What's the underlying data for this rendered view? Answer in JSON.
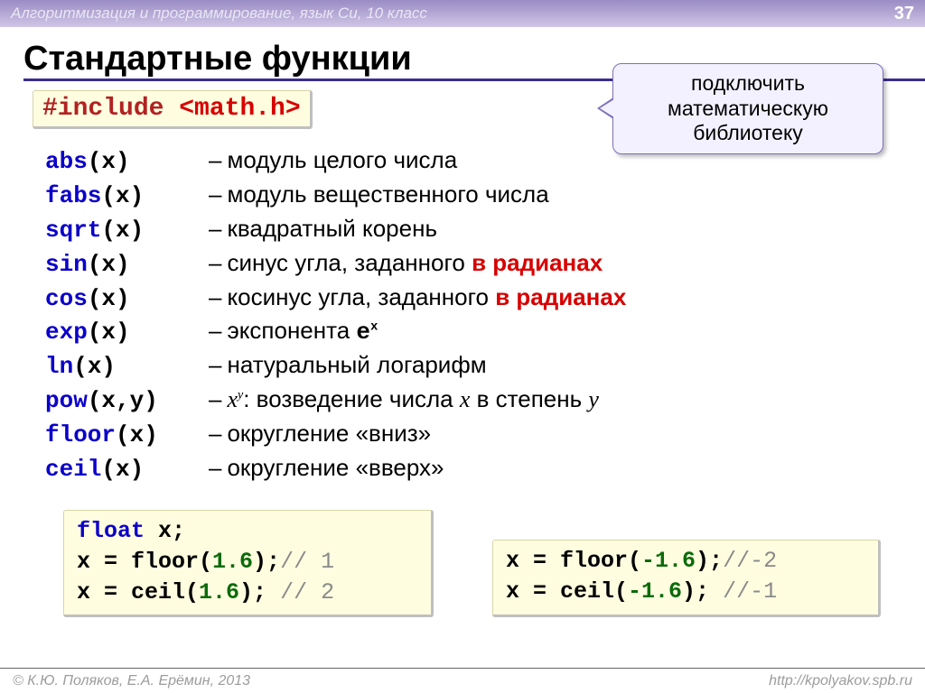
{
  "header": {
    "course": "Алгоритмизация и программирование, язык Си, 10 класс",
    "page": "37"
  },
  "heading": "Стандартные функции",
  "include": {
    "directive": "#include",
    "lib": "<math.h>"
  },
  "callout": "подключить математическую библиотеку",
  "functions": [
    {
      "name": "abs",
      "sig": "(x)",
      "desc_pre": "модуль целого числа",
      "desc_red": "",
      "desc_post": ""
    },
    {
      "name": "fabs",
      "sig": "(x)",
      "desc_pre": "модуль вещественного числа",
      "desc_red": "",
      "desc_post": ""
    },
    {
      "name": "sqrt",
      "sig": "(x)",
      "desc_pre": "квадратный корень",
      "desc_red": "",
      "desc_post": ""
    },
    {
      "name": "sin",
      "sig": "(x)",
      "desc_pre": "синус угла, заданного ",
      "desc_red": "в радианах",
      "desc_post": ""
    },
    {
      "name": "cos",
      "sig": "(x)",
      "desc_pre": "косинус угла, заданного ",
      "desc_red": "в радианах",
      "desc_post": ""
    },
    {
      "name": "exp",
      "sig": "(x)",
      "desc_pre": "экспонента ",
      "desc_red": "",
      "desc_post": "",
      "math_base": "e",
      "math_sup": "x"
    },
    {
      "name": "ln",
      "sig": "(x)",
      "desc_pre": "натуральный логарифм",
      "desc_red": "",
      "desc_post": ""
    },
    {
      "name": "pow",
      "sig": "(x,y)",
      "desc_pre": "",
      "pow_base": "x",
      "pow_sup": "y",
      "desc_tail": ": возведение числа ",
      "ital1": "x",
      "desc_tail2": " в степень ",
      "ital2": "y"
    },
    {
      "name": "floor",
      "sig": "(x)",
      "desc_pre": "округление «вниз»",
      "desc_red": "",
      "desc_post": ""
    },
    {
      "name": "ceil",
      "sig": "(x)",
      "desc_pre": "округление «вверх»",
      "desc_red": "",
      "desc_post": ""
    }
  ],
  "example_left": {
    "l1_type": "float",
    "l1_rest": " x;",
    "l2a": "x = floor(",
    "l2n": "1.6",
    "l2b": ");",
    "l2c": "// 1",
    "l3a": "x = ceil(",
    "l3n": "1.6",
    "l3b": "); ",
    "l3c": "// 2"
  },
  "example_right": {
    "l2a": "x = floor(",
    "l2n": "-1.6",
    "l2b": ");",
    "l2c": "//-2",
    "l3a": "x = ceil(",
    "l3n": "-1.6",
    "l3b": "); ",
    "l3c": "//-1"
  },
  "footer": {
    "left": "© К.Ю. Поляков, Е.А. Ерёмин, 2013",
    "right": "http://kpolyakov.spb.ru"
  }
}
